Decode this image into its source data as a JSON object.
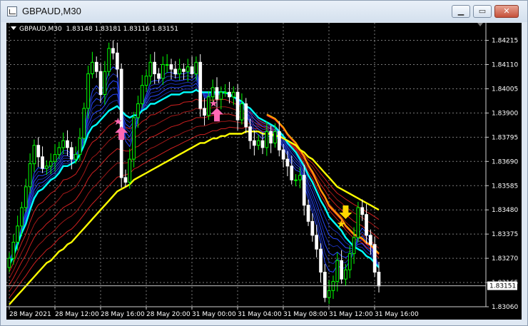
{
  "window": {
    "title": "GBPAUD,M30",
    "buttons": {
      "minimize": "minimize",
      "maximize": "maximize",
      "close": "close"
    }
  },
  "chart_header": {
    "symbol": "GBPAUD,M30",
    "ohlc": "1.83148 1.83181 1.83116 1.83151"
  },
  "chart_data": {
    "type": "candlestick",
    "symbol": "GBPAUD",
    "timeframe": "M30",
    "background": "#000000",
    "grid": true,
    "ylim": [
      1.8306,
      1.8426
    ],
    "y_ticks": [
      "1.84215",
      "1.84110",
      "1.84005",
      "1.83900",
      "1.83795",
      "1.83690",
      "1.83585",
      "1.83480",
      "1.83375",
      "1.83270",
      "1.83165",
      "1.83060"
    ],
    "x_ticks": [
      "28 May 2021",
      "28 May 12:00",
      "28 May 16:00",
      "28 May 20:00",
      "31 May 00:00",
      "31 May 04:00",
      "31 May 08:00",
      "31 May 12:00",
      "31 May 16:00"
    ],
    "current_price": "1.83151",
    "colors": {
      "bull": "#00ff00",
      "bear": "#ffffff",
      "ema200": "#ffff00",
      "ema_mid": "#00ffff",
      "ribbon_red": "#ff3030",
      "ribbon_blue": "#2040ff",
      "arrow_up": "#ff69b4",
      "arrow_down": "#ffd700"
    },
    "close": [
      1.8327,
      1.8334,
      1.8341,
      1.8349,
      1.8358,
      1.8368,
      1.8376,
      1.8371,
      1.8366,
      1.8367,
      1.8369,
      1.8372,
      1.8375,
      1.8378,
      1.8375,
      1.837,
      1.8372,
      1.8379,
      1.8392,
      1.8407,
      1.8412,
      1.8408,
      1.8398,
      1.8408,
      1.8418,
      1.8416,
      1.8409,
      1.8362,
      1.836,
      1.837,
      1.8388,
      1.8394,
      1.8402,
      1.8406,
      1.8412,
      1.8407,
      1.8405,
      1.8411,
      1.8411,
      1.8409,
      1.8407,
      1.8409,
      1.8408,
      1.841,
      1.8407,
      1.8412,
      1.8392,
      1.8389,
      1.8397,
      1.8401,
      1.8396,
      1.8399,
      1.8399,
      1.8397,
      1.8399,
      1.8387,
      1.8394,
      1.8384,
      1.8378,
      1.8376,
      1.8378,
      1.8375,
      1.8382,
      1.8377,
      1.8382,
      1.8374,
      1.837,
      1.8367,
      1.8361,
      1.8361,
      1.8363,
      1.835,
      1.8343,
      1.8337,
      1.8331,
      1.8321,
      1.831,
      1.8313,
      1.8317,
      1.8326,
      1.8318,
      1.8322,
      1.8329,
      1.8336,
      1.8349,
      1.8346,
      1.8337,
      1.8333,
      1.8321,
      1.8315
    ],
    "ema_mid": [
      1.8324,
      1.8328,
      1.8333,
      1.8338,
      1.8342,
      1.8348,
      1.8353,
      1.8356,
      1.8357,
      1.8359,
      1.8361,
      1.8362,
      1.8364,
      1.8367,
      1.8367,
      1.8368,
      1.8369,
      1.8372,
      1.8376,
      1.8381,
      1.8384,
      1.8385,
      1.8387,
      1.8389,
      1.8391,
      1.8392,
      1.8393,
      1.8391,
      1.8389,
      1.8388,
      1.8389,
      1.8389,
      1.8391,
      1.8392,
      1.8394,
      1.8394,
      1.8395,
      1.8396,
      1.8397,
      1.8398,
      1.8398,
      1.8398,
      1.8399,
      1.8399,
      1.8399,
      1.84,
      1.8399,
      1.8399,
      1.8399,
      1.8399,
      1.8399,
      1.8399,
      1.8399,
      1.8398,
      1.8397,
      1.8396,
      1.8395,
      1.8393,
      1.8392,
      1.839,
      1.8388,
      1.8387,
      1.8386,
      1.8385,
      1.8384,
      1.8382,
      1.838,
      1.8377,
      1.8375,
      1.8373,
      1.837,
      1.8367,
      1.8363,
      1.836,
      1.8356,
      1.8352,
      1.8349,
      1.8345,
      1.8343,
      1.8341,
      1.8339,
      1.8336,
      1.8334,
      1.8332,
      1.8331,
      1.833,
      1.8328,
      1.8327,
      1.8325,
      1.8323
    ],
    "ema200": [
      1.8307,
      1.8309,
      1.8311,
      1.8313,
      1.8315,
      1.8317,
      1.8319,
      1.8321,
      1.8323,
      1.8325,
      1.8326,
      1.8328,
      1.833,
      1.8331,
      1.8333,
      1.8334,
      1.8336,
      1.8338,
      1.834,
      1.8342,
      1.8344,
      1.8346,
      1.8348,
      1.835,
      1.8352,
      1.8354,
      1.8356,
      1.8357,
      1.8358,
      1.8359,
      1.8361,
      1.8362,
      1.8363,
      1.8364,
      1.8365,
      1.8366,
      1.8367,
      1.8368,
      1.8369,
      1.837,
      1.8371,
      1.8372,
      1.8373,
      1.8374,
      1.8375,
      1.8376,
      1.8377,
      1.8377,
      1.8378,
      1.8379,
      1.8379,
      1.838,
      1.838,
      1.8381,
      1.8381,
      1.8381,
      1.8381,
      1.8382,
      1.8382,
      1.8382,
      1.8382,
      1.8381,
      1.8381,
      1.8381,
      1.838,
      1.838,
      1.8379,
      1.8378,
      1.8377,
      1.8376,
      1.8374,
      1.8373,
      1.8371,
      1.837,
      1.8368,
      1.8366,
      1.8364,
      1.8362,
      1.836,
      1.8358,
      1.8357,
      1.8356,
      1.8355,
      1.8354,
      1.8353,
      1.8352,
      1.8351,
      1.835,
      1.8349,
      1.8348
    ],
    "signals": [
      {
        "type": "buy",
        "bar": 27
      },
      {
        "type": "buy",
        "bar": 50
      },
      {
        "type": "sell",
        "bar": 81
      }
    ]
  }
}
